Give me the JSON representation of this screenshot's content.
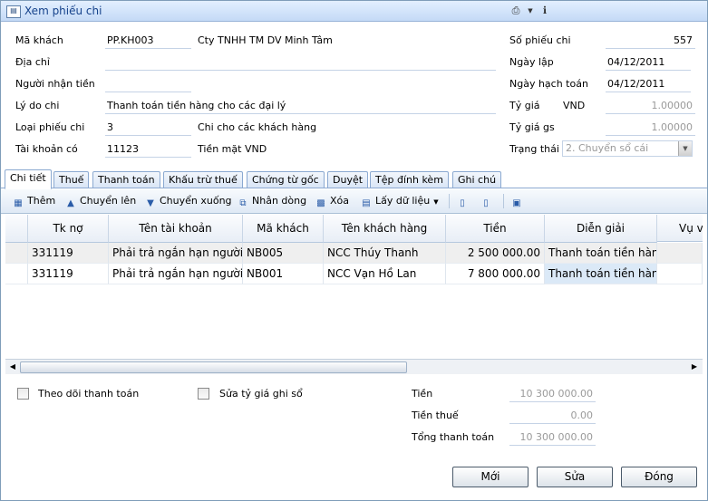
{
  "window": {
    "title": "Xem phiếu chi"
  },
  "header": {
    "ma_khach": {
      "label": "Mã khách",
      "code": "PP.KH003",
      "name": "Cty TNHH TM DV Minh Tâm"
    },
    "dia_chi": {
      "label": "Địa chỉ",
      "value": ""
    },
    "nguoi_nhan": {
      "label": "Người nhận tiền",
      "value": ""
    },
    "ly_do": {
      "label": "Lý do chi",
      "value": "Thanh toán tiền hàng cho các đại lý"
    },
    "loai_phieu": {
      "label": "Loại phiếu chi",
      "code": "3",
      "name": "Chi cho các khách hàng"
    },
    "tai_khoan": {
      "label": "Tài khoản có",
      "code": "11123",
      "name": "Tiền mặt VND"
    },
    "so_phieu": {
      "label": "Số phiếu chi",
      "value": "557"
    },
    "ngay_lap": {
      "label": "Ngày lập",
      "value": "04/12/2011"
    },
    "ngay_hach_toan": {
      "label": "Ngày hạch toán",
      "value": "04/12/2011"
    },
    "ty_gia": {
      "label": "Tỷ giá",
      "currency": "VND",
      "value": "1.00000"
    },
    "ty_gia_gs": {
      "label": "Tỷ giá gs",
      "value": "1.00000"
    },
    "trang_thai": {
      "label": "Trạng thái",
      "value": "2. Chuyển sổ cái"
    }
  },
  "tabs": [
    "Chi tiết",
    "Thuế",
    "Thanh toán",
    "Khấu trừ thuế",
    "Chứng từ gốc",
    "Duyệt",
    "Tệp đính kèm",
    "Ghi chú"
  ],
  "toolbar": {
    "them": "Thêm",
    "chuyen_len": "Chuyển lên",
    "chuyen_xuong": "Chuyển xuống",
    "nhan_dong": "Nhân dòng",
    "xoa": "Xóa",
    "lay_du_lieu": "Lấy dữ liệu"
  },
  "grid": {
    "columns": [
      "Tk nợ",
      "Tên tài khoản",
      "Mã khách",
      "Tên khách hàng",
      "Tiền",
      "Diễn giải",
      "Vụ v"
    ],
    "rows": [
      [
        "331119",
        "Phải trả ngắn hạn người",
        "NB005",
        "NCC Thúy Thanh",
        "2 500 000.00",
        "Thanh toán tiền hàng",
        ""
      ],
      [
        "331119",
        "Phải trả ngắn hạn người",
        "NB001",
        "NCC Vạn Hồ Lan",
        "7 800 000.00",
        "Thanh toán tiền hàng",
        ""
      ]
    ]
  },
  "footer": {
    "theo_doi": "Theo dõi thanh toán",
    "sua_ty_gia": "Sửa tỷ giá ghi sổ",
    "tien": {
      "label": "Tiền",
      "value": "10 300 000.00"
    },
    "tien_thue": {
      "label": "Tiền thuế",
      "value": "0.00"
    },
    "tong": {
      "label": "Tổng thanh toán",
      "value": "10 300 000.00"
    }
  },
  "buttons": {
    "moi": "Mới",
    "sua": "Sửa",
    "dong": "Đóng"
  }
}
